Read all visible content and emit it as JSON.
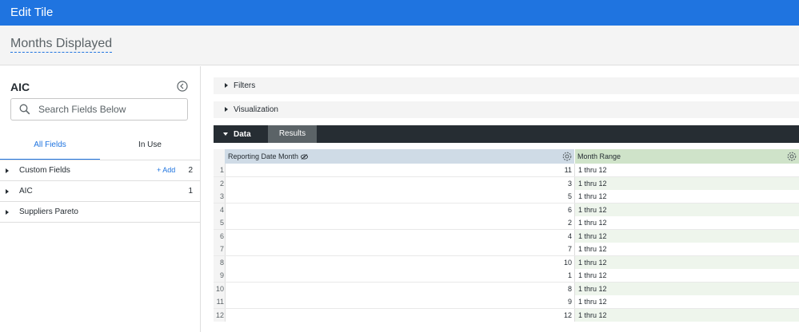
{
  "header": {
    "title": "Edit Tile"
  },
  "tile": {
    "title": "Months Displayed"
  },
  "sidebar": {
    "model_name": "AIC",
    "search": {
      "placeholder": "Search Fields Below",
      "value": ""
    },
    "tabs": [
      {
        "label": "All Fields",
        "active": true
      },
      {
        "label": "In Use",
        "active": false
      }
    ],
    "fields": [
      {
        "label": "Custom Fields",
        "add_label": "+ Add",
        "count": "2"
      },
      {
        "label": "AIC",
        "add_label": "",
        "count": "1"
      },
      {
        "label": "Suppliers Pareto",
        "add_label": "",
        "count": ""
      }
    ]
  },
  "main": {
    "sections": [
      {
        "label": "Filters"
      },
      {
        "label": "Visualization"
      }
    ],
    "data_tab_label": "Data",
    "results_tab_label": "Results",
    "table": {
      "columns": [
        {
          "label": "Reporting Date Month"
        },
        {
          "label": "Month Range"
        }
      ],
      "rows": [
        {
          "n": "1",
          "value": "11",
          "range": "1 thru 12"
        },
        {
          "n": "2",
          "value": "3",
          "range": "1 thru 12"
        },
        {
          "n": "3",
          "value": "5",
          "range": "1 thru 12"
        },
        {
          "n": "4",
          "value": "6",
          "range": "1 thru 12"
        },
        {
          "n": "5",
          "value": "2",
          "range": "1 thru 12"
        },
        {
          "n": "6",
          "value": "4",
          "range": "1 thru 12"
        },
        {
          "n": "7",
          "value": "7",
          "range": "1 thru 12"
        },
        {
          "n": "8",
          "value": "10",
          "range": "1 thru 12"
        },
        {
          "n": "9",
          "value": "1",
          "range": "1 thru 12"
        },
        {
          "n": "10",
          "value": "8",
          "range": "1 thru 12"
        },
        {
          "n": "11",
          "value": "9",
          "range": "1 thru 12"
        },
        {
          "n": "12",
          "value": "12",
          "range": "1 thru 12"
        }
      ]
    }
  },
  "colors": {
    "header_bg": "#1f74e0",
    "accent": "#1f74e0",
    "data_bar": "#262d33",
    "dimension_header": "#cfdbe6",
    "measure_header": "#cfe3c9"
  }
}
